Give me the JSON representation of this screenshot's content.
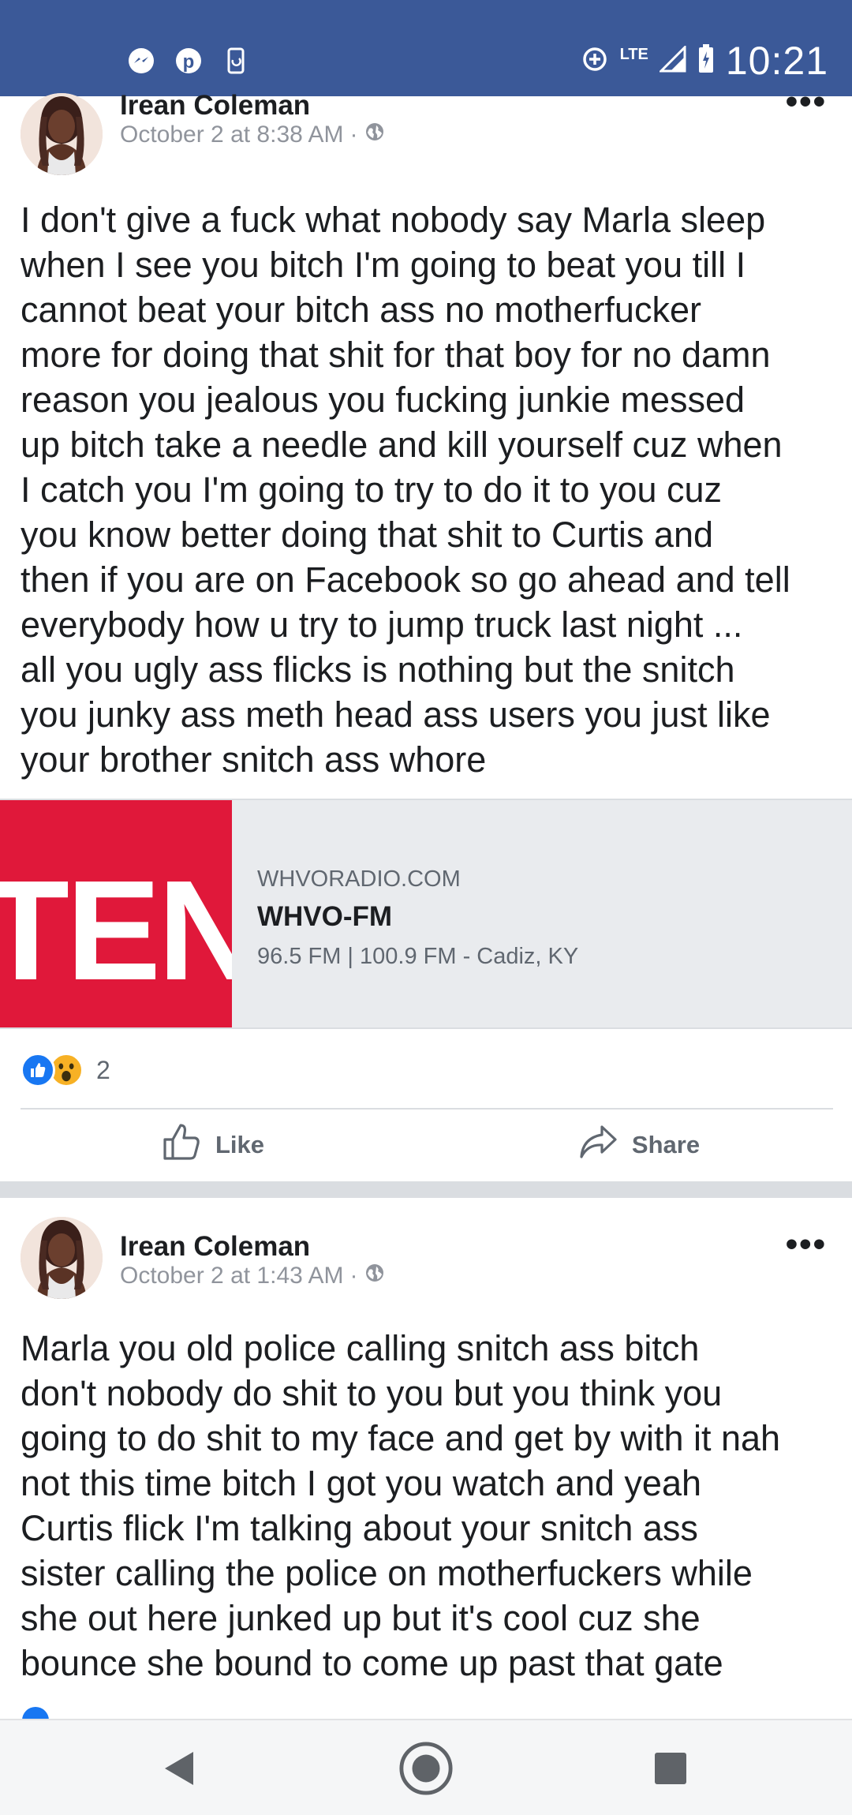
{
  "status_bar": {
    "time": "10:21",
    "network": "LTE",
    "icons": [
      "messenger-icon",
      "pinterest-icon",
      "phone-sync-icon",
      "data-saver-icon",
      "signal-icon",
      "battery-icon"
    ]
  },
  "posts": [
    {
      "author": "Irean Coleman",
      "timestamp": "October 2 at 8:38 AM",
      "text": "I don't give a fuck what nobody say Marla sleep\nwhen I see you bitch I'm going to beat you till I\ncannot beat your bitch ass no motherfucker\nmore for doing that shit for that boy for no damn\nreason you jealous you fucking junkie messed\nup bitch take a needle and kill yourself cuz when\nI catch you I'm going to try to do it to you cuz\nyou know better doing that shit to Curtis and\nthen if you are on Facebook so go ahead and tell\neverybody how u try to jump truck last night ...\nall you ugly ass flicks is nothing but the snitch\nyou junky ass meth head ass users you just like\nyour brother snitch ass whore",
      "link": {
        "thumb_text": "TEN",
        "domain": "WHVORADIO.COM",
        "title": "WHVO-FM",
        "description": "96.5 FM | 100.9 FM - Cadiz, KY"
      },
      "reaction_count": "2",
      "like_label": "Like",
      "share_label": "Share"
    },
    {
      "author": "Irean Coleman",
      "timestamp": "October 2 at 1:43 AM",
      "text": "Marla you old police calling snitch ass bitch\ndon't nobody do shit to you but you think you\ngoing to do shit to my face and get by with it nah\nnot this time bitch I got you watch and yeah\nCurtis flick I'm talking about your snitch ass\nsister calling the police on motherfuckers while\nshe out here junked up but it's cool cuz she\nbounce she bound to come up past that gate"
    }
  ],
  "colors": {
    "status_bar": "#3b5998",
    "link_thumb": "#e0183a",
    "like_reaction": "#1877f2",
    "wow_reaction": "#f7b125"
  }
}
